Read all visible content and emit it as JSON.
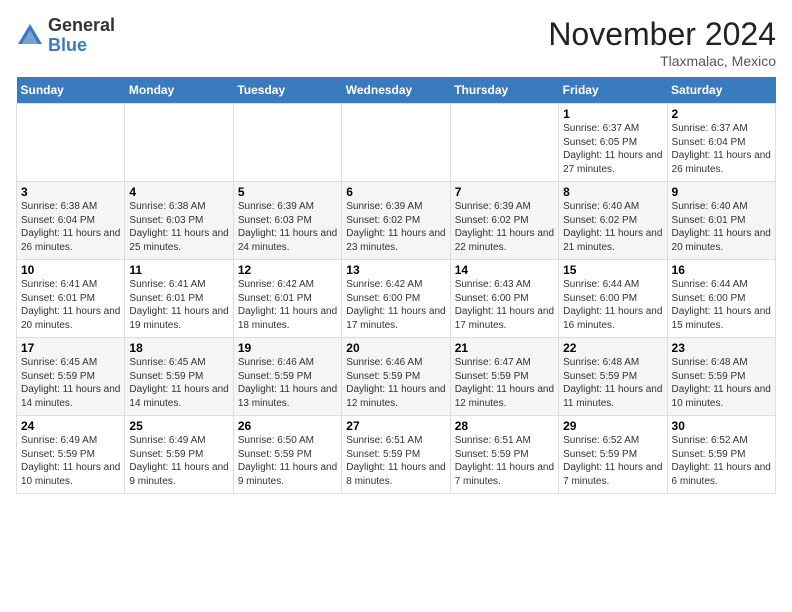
{
  "header": {
    "logo_general": "General",
    "logo_blue": "Blue",
    "month_title": "November 2024",
    "location": "Tlaxmalac, Mexico"
  },
  "weekdays": [
    "Sunday",
    "Monday",
    "Tuesday",
    "Wednesday",
    "Thursday",
    "Friday",
    "Saturday"
  ],
  "weeks": [
    [
      {
        "day": "",
        "info": ""
      },
      {
        "day": "",
        "info": ""
      },
      {
        "day": "",
        "info": ""
      },
      {
        "day": "",
        "info": ""
      },
      {
        "day": "",
        "info": ""
      },
      {
        "day": "1",
        "info": "Sunrise: 6:37 AM\nSunset: 6:05 PM\nDaylight: 11 hours and 27 minutes."
      },
      {
        "day": "2",
        "info": "Sunrise: 6:37 AM\nSunset: 6:04 PM\nDaylight: 11 hours and 26 minutes."
      }
    ],
    [
      {
        "day": "3",
        "info": "Sunrise: 6:38 AM\nSunset: 6:04 PM\nDaylight: 11 hours and 26 minutes."
      },
      {
        "day": "4",
        "info": "Sunrise: 6:38 AM\nSunset: 6:03 PM\nDaylight: 11 hours and 25 minutes."
      },
      {
        "day": "5",
        "info": "Sunrise: 6:39 AM\nSunset: 6:03 PM\nDaylight: 11 hours and 24 minutes."
      },
      {
        "day": "6",
        "info": "Sunrise: 6:39 AM\nSunset: 6:02 PM\nDaylight: 11 hours and 23 minutes."
      },
      {
        "day": "7",
        "info": "Sunrise: 6:39 AM\nSunset: 6:02 PM\nDaylight: 11 hours and 22 minutes."
      },
      {
        "day": "8",
        "info": "Sunrise: 6:40 AM\nSunset: 6:02 PM\nDaylight: 11 hours and 21 minutes."
      },
      {
        "day": "9",
        "info": "Sunrise: 6:40 AM\nSunset: 6:01 PM\nDaylight: 11 hours and 20 minutes."
      }
    ],
    [
      {
        "day": "10",
        "info": "Sunrise: 6:41 AM\nSunset: 6:01 PM\nDaylight: 11 hours and 20 minutes."
      },
      {
        "day": "11",
        "info": "Sunrise: 6:41 AM\nSunset: 6:01 PM\nDaylight: 11 hours and 19 minutes."
      },
      {
        "day": "12",
        "info": "Sunrise: 6:42 AM\nSunset: 6:01 PM\nDaylight: 11 hours and 18 minutes."
      },
      {
        "day": "13",
        "info": "Sunrise: 6:42 AM\nSunset: 6:00 PM\nDaylight: 11 hours and 17 minutes."
      },
      {
        "day": "14",
        "info": "Sunrise: 6:43 AM\nSunset: 6:00 PM\nDaylight: 11 hours and 17 minutes."
      },
      {
        "day": "15",
        "info": "Sunrise: 6:44 AM\nSunset: 6:00 PM\nDaylight: 11 hours and 16 minutes."
      },
      {
        "day": "16",
        "info": "Sunrise: 6:44 AM\nSunset: 6:00 PM\nDaylight: 11 hours and 15 minutes."
      }
    ],
    [
      {
        "day": "17",
        "info": "Sunrise: 6:45 AM\nSunset: 5:59 PM\nDaylight: 11 hours and 14 minutes."
      },
      {
        "day": "18",
        "info": "Sunrise: 6:45 AM\nSunset: 5:59 PM\nDaylight: 11 hours and 14 minutes."
      },
      {
        "day": "19",
        "info": "Sunrise: 6:46 AM\nSunset: 5:59 PM\nDaylight: 11 hours and 13 minutes."
      },
      {
        "day": "20",
        "info": "Sunrise: 6:46 AM\nSunset: 5:59 PM\nDaylight: 11 hours and 12 minutes."
      },
      {
        "day": "21",
        "info": "Sunrise: 6:47 AM\nSunset: 5:59 PM\nDaylight: 11 hours and 12 minutes."
      },
      {
        "day": "22",
        "info": "Sunrise: 6:48 AM\nSunset: 5:59 PM\nDaylight: 11 hours and 11 minutes."
      },
      {
        "day": "23",
        "info": "Sunrise: 6:48 AM\nSunset: 5:59 PM\nDaylight: 11 hours and 10 minutes."
      }
    ],
    [
      {
        "day": "24",
        "info": "Sunrise: 6:49 AM\nSunset: 5:59 PM\nDaylight: 11 hours and 10 minutes."
      },
      {
        "day": "25",
        "info": "Sunrise: 6:49 AM\nSunset: 5:59 PM\nDaylight: 11 hours and 9 minutes."
      },
      {
        "day": "26",
        "info": "Sunrise: 6:50 AM\nSunset: 5:59 PM\nDaylight: 11 hours and 9 minutes."
      },
      {
        "day": "27",
        "info": "Sunrise: 6:51 AM\nSunset: 5:59 PM\nDaylight: 11 hours and 8 minutes."
      },
      {
        "day": "28",
        "info": "Sunrise: 6:51 AM\nSunset: 5:59 PM\nDaylight: 11 hours and 7 minutes."
      },
      {
        "day": "29",
        "info": "Sunrise: 6:52 AM\nSunset: 5:59 PM\nDaylight: 11 hours and 7 minutes."
      },
      {
        "day": "30",
        "info": "Sunrise: 6:52 AM\nSunset: 5:59 PM\nDaylight: 11 hours and 6 minutes."
      }
    ]
  ]
}
